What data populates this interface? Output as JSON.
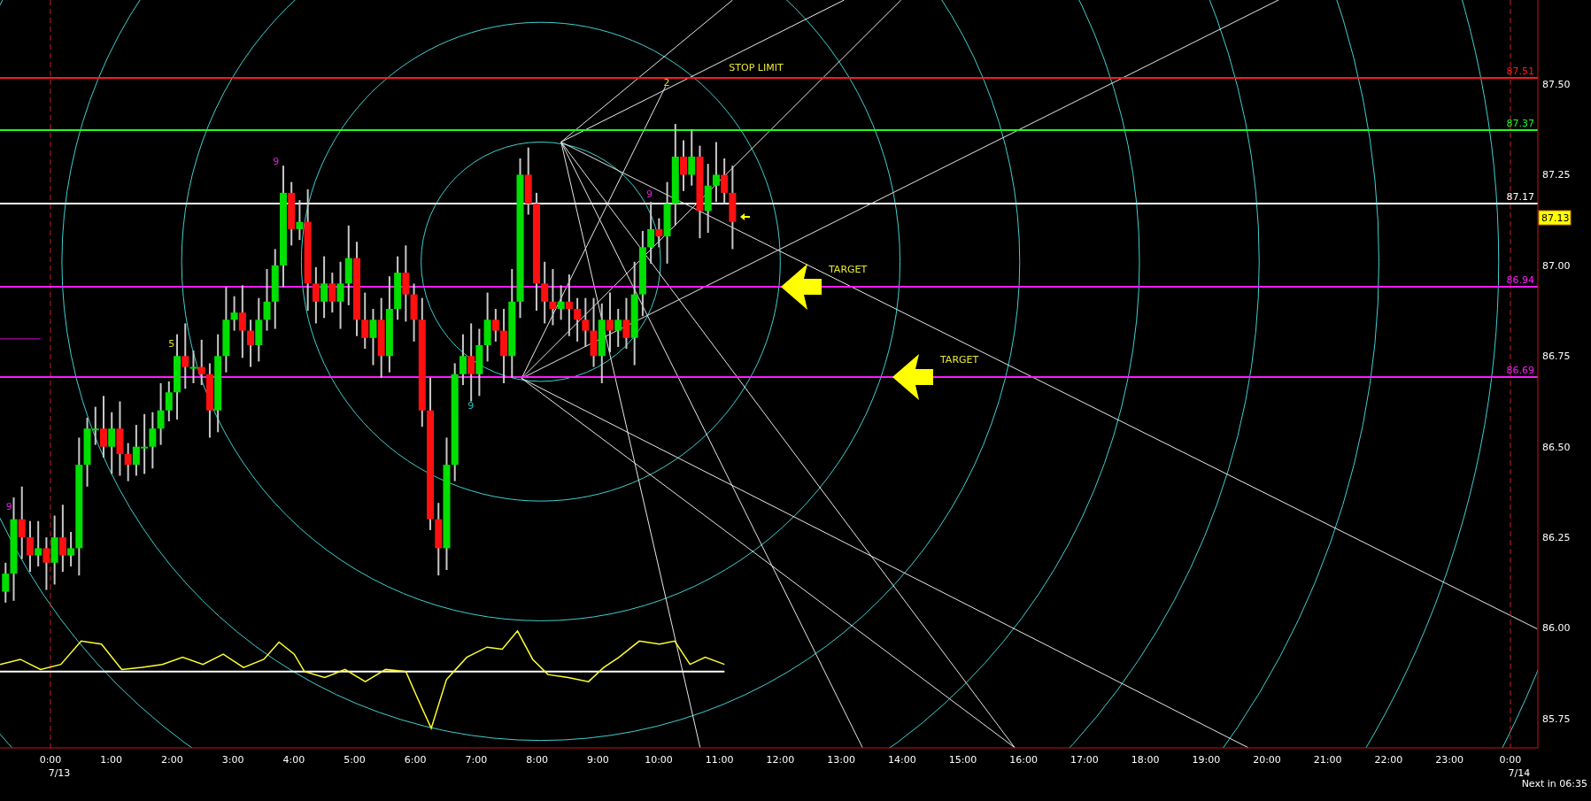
{
  "chart": {
    "levels": [
      {
        "label": "87.51",
        "color": "#ff1a1a",
        "kind": "stop",
        "note": "STOP LIMIT"
      },
      {
        "label": "87.37",
        "color": "#1aff1a",
        "kind": "plain"
      },
      {
        "label": "87.17",
        "color": "#ffffff",
        "kind": "plain"
      },
      {
        "label": "86.94",
        "color": "#ff1aff",
        "kind": "target",
        "note": "TARGET"
      },
      {
        "label": "86.69",
        "color": "#ff1aff",
        "kind": "target",
        "note": "TARGET"
      }
    ],
    "current_price": "87.13",
    "bar_counts": [
      {
        "label": "9",
        "color": "#e020e0"
      },
      {
        "label": "5",
        "color": "#e0e020"
      },
      {
        "label": "9",
        "color": "#e020e0"
      },
      {
        "label": "9",
        "color": "#20c0c0"
      },
      {
        "label": "9",
        "color": "#e020e0"
      },
      {
        "label": "2",
        "color": "#e0e020"
      }
    ],
    "price_axis": [
      "87.50",
      "87.25",
      "87.00",
      "86.75",
      "86.50",
      "86.25",
      "86.00",
      "85.75"
    ],
    "time_axis": [
      {
        "label": "0:00",
        "date": "7/13"
      },
      {
        "label": "1:00"
      },
      {
        "label": "2:00"
      },
      {
        "label": "3:00"
      },
      {
        "label": "4:00"
      },
      {
        "label": "5:00"
      },
      {
        "label": "6:00"
      },
      {
        "label": "7:00"
      },
      {
        "label": "8:00"
      },
      {
        "label": "9:00"
      },
      {
        "label": "10:00"
      },
      {
        "label": "11:00"
      },
      {
        "label": "12:00"
      },
      {
        "label": "13:00"
      },
      {
        "label": "14:00"
      },
      {
        "label": "15:00"
      },
      {
        "label": "16:00"
      },
      {
        "label": "17:00"
      },
      {
        "label": "18:00"
      },
      {
        "label": "19:00"
      },
      {
        "label": "20:00"
      },
      {
        "label": "21:00"
      },
      {
        "label": "22:00"
      },
      {
        "label": "23:00"
      },
      {
        "label": "0:00",
        "date": "7/14"
      }
    ],
    "countdown": "Next in 06:35"
  }
}
